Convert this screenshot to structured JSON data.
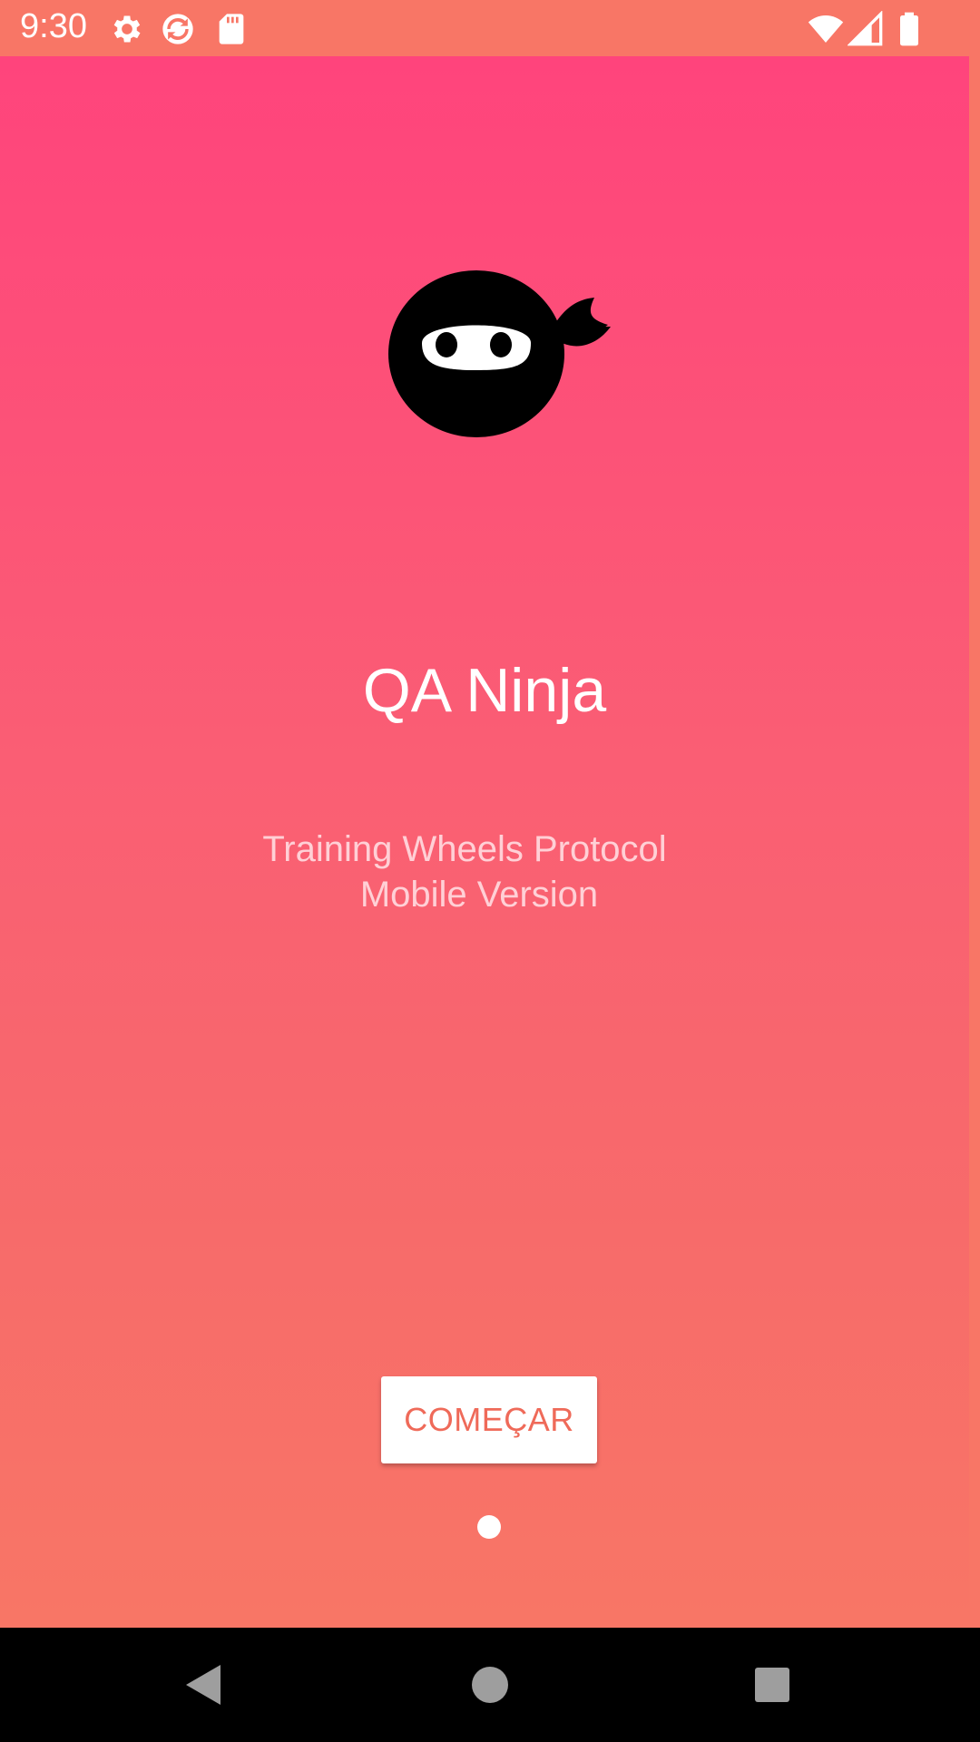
{
  "status_bar": {
    "time": "9:30",
    "icons": [
      "gear-icon",
      "sync-icon",
      "sd-card-icon",
      "wifi-icon",
      "cell-signal-icon",
      "battery-icon"
    ]
  },
  "app": {
    "logo": "ninja-logo-icon",
    "title": "QA Ninja",
    "subtitle_line1": "Training Wheels Protocol",
    "subtitle_line2": "Mobile Version",
    "start_button_label": "COMEÇAR",
    "page_indicator": {
      "current": 1,
      "total": 1
    }
  },
  "nav_bar": {
    "buttons": [
      "back-icon",
      "home-icon",
      "recents-icon"
    ]
  },
  "colors": {
    "gradient_top": "#ff447c",
    "gradient_bottom": "#f87666",
    "status_bar": "#f87666",
    "button_text": "#ef6a59",
    "subtitle": "#ffd0d6"
  }
}
